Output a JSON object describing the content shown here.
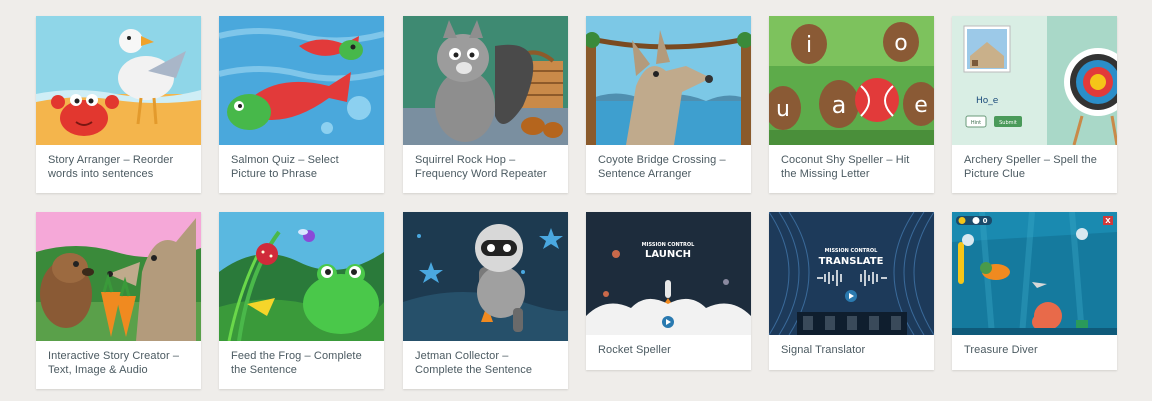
{
  "cards": [
    {
      "title": "Story Arranger – Reorder words into sentences",
      "art": "seagull-crab-icon"
    },
    {
      "title": "Salmon Quiz – Select Picture to Phrase",
      "art": "salmon-icon"
    },
    {
      "title": "Squirrel Rock Hop – Frequency Word Repeater",
      "art": "squirrel-icon"
    },
    {
      "title": "Coyote Bridge Crossing – Sentence Arranger",
      "art": "coyote-icon"
    },
    {
      "title": "Coconut Shy Speller – Hit the Missing Letter",
      "art": "coconut-icon"
    },
    {
      "title": "Archery Speller – Spell the Picture Clue",
      "art": "archery-target-icon",
      "art_text": {
        "word": "Ho_e",
        "hint_button": "Hint",
        "submit_button": "Submit"
      }
    },
    {
      "title": "Interactive Story Creator – Text, Image & Audio",
      "art": "beaver-coyote-icon"
    },
    {
      "title": "Feed the Frog – Complete the Sentence",
      "art": "frog-icon"
    },
    {
      "title": "Jetman Collector – Complete the Sentence",
      "art": "jetman-icon"
    },
    {
      "title": "Rocket Speller",
      "art": "rocket-icon",
      "art_text": {
        "line1": "MISSION CONTROL",
        "line2": "LAUNCH"
      }
    },
    {
      "title": "Signal Translator",
      "art": "satellite-icon",
      "art_text": {
        "line1": "MISSION CONTROL",
        "line2": "TRANSLATE"
      }
    },
    {
      "title": "Treasure Diver",
      "art": "diver-icon",
      "art_text": {
        "coin_count": "0",
        "close": "X"
      }
    }
  ],
  "colors": {
    "page_bg": "#efedea",
    "card_bg": "#ffffff",
    "caption_text": "#4b5a61"
  }
}
